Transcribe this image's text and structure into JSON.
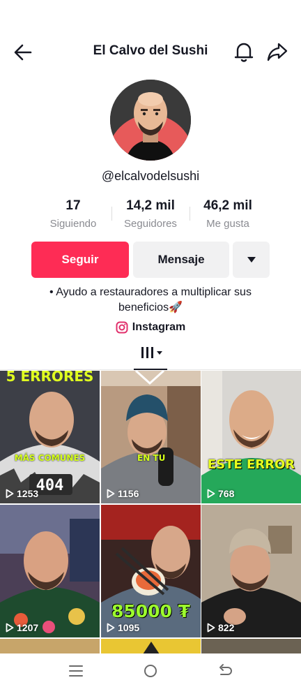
{
  "header": {
    "title": "El Calvo del Sushi",
    "back_icon": "arrow-left-icon",
    "bell_icon": "bell-icon",
    "share_icon": "share-arrow-icon"
  },
  "profile": {
    "handle": "@elcalvodelsushi",
    "stats": [
      {
        "value": "17",
        "label": "Siguiendo"
      },
      {
        "value": "14,2 mil",
        "label": "Seguidores"
      },
      {
        "value": "46,2 mil",
        "label": "Me gusta"
      }
    ],
    "buttons": {
      "follow": "Seguir",
      "message": "Mensaje"
    },
    "bio_line1": "• Ayudo a restauradores a multiplicar sus",
    "bio_line2": "beneficios🚀",
    "link_label": "Instagram"
  },
  "colors": {
    "accent": "#fe2c55",
    "secondary_button": "#f1f1f2",
    "muted_text": "#8a8b91"
  },
  "videos": [
    {
      "views": "1253",
      "overlay_top": "5 ERRORES",
      "overlay_mid": "MÁS COMUNES"
    },
    {
      "views": "1156",
      "overlay_mid": "EN TU"
    },
    {
      "views": "768",
      "overlay_mid": "ESTE ERROR"
    },
    {
      "views": "1207"
    },
    {
      "views": "1095",
      "overlay_bottom": "85000 ₮"
    },
    {
      "views": "822"
    }
  ],
  "navbar": {
    "menu_icon": "recent-apps-icon",
    "home_icon": "home-circle-icon",
    "back_icon": "system-back-icon"
  }
}
